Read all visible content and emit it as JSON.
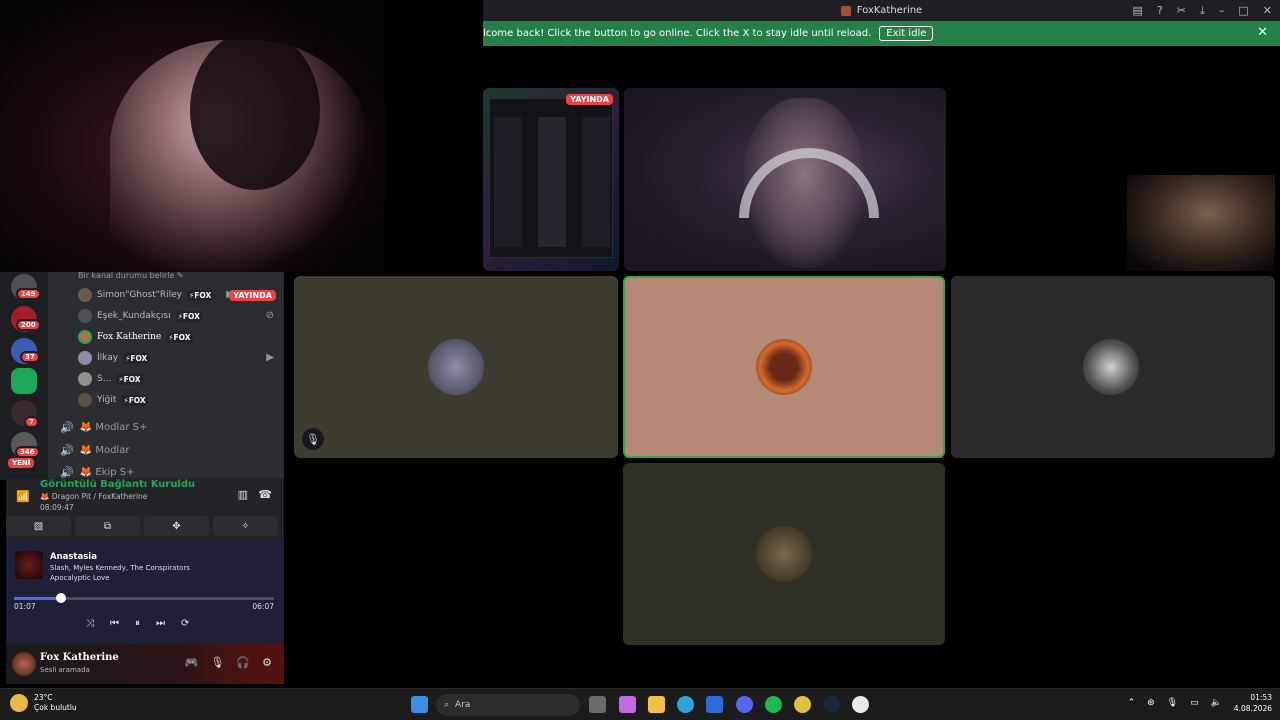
{
  "window": {
    "title": "FoxKatherine",
    "icons": [
      "inbox-icon",
      "help-icon",
      "tools-icon",
      "download-icon"
    ],
    "controls": [
      "–",
      "□",
      "✕"
    ]
  },
  "banner": {
    "message": "lcome back! Click the button to go online. Click the X to stay idle until reload.",
    "button": "Exit idle",
    "close": "✕"
  },
  "stage": {
    "screen_live": "YAYINDA"
  },
  "rail": {
    "badges": [
      "149",
      "200",
      "37",
      "7",
      "346"
    ],
    "new_label": "YENİ"
  },
  "channel": {
    "status_hint": "Bir kanal durumu belirle ✎",
    "users": [
      {
        "name": "Simon\"Ghost\"Riley",
        "tag": "⚡FOX",
        "live": "YAYINDA"
      },
      {
        "name": "Eşek_Kundakçısı",
        "tag": "⚡FOX"
      },
      {
        "name": "Fox Katherine",
        "tag": "⚡FOX"
      },
      {
        "name": "İlkay",
        "tag": "⚡FOX"
      },
      {
        "name": "S...",
        "tag": "⚡FOX"
      },
      {
        "name": "Yiğit",
        "tag": "⚡FOX"
      }
    ],
    "voice_channels": [
      "🦊 Modlar S+",
      "🦊 Modlar",
      "🦊 Ekip S+"
    ]
  },
  "voice": {
    "status": "Görüntülü Bağlantı Kuruldu",
    "location": "🦊 Dragon Pit / FoxKatherine",
    "elapsed": "08:09:47"
  },
  "music": {
    "song": "Anastasia",
    "artist": "Slash, Myles Kennedy, The Conspirators",
    "album": "Apocalyptic Love",
    "current": "01:07",
    "total": "06:07",
    "progress": 0.18
  },
  "user": {
    "name": "Fox Katherine",
    "status": "Sesli aramada"
  },
  "taskbar": {
    "temp": "23°C",
    "weather": "Çok bulutlu",
    "search": "Ara",
    "time": "01:53",
    "date": "4.08.2026"
  },
  "colors": {
    "accent": "#5865f2",
    "online": "#23a55a",
    "danger": "#ed4245",
    "banner": "#248046"
  }
}
